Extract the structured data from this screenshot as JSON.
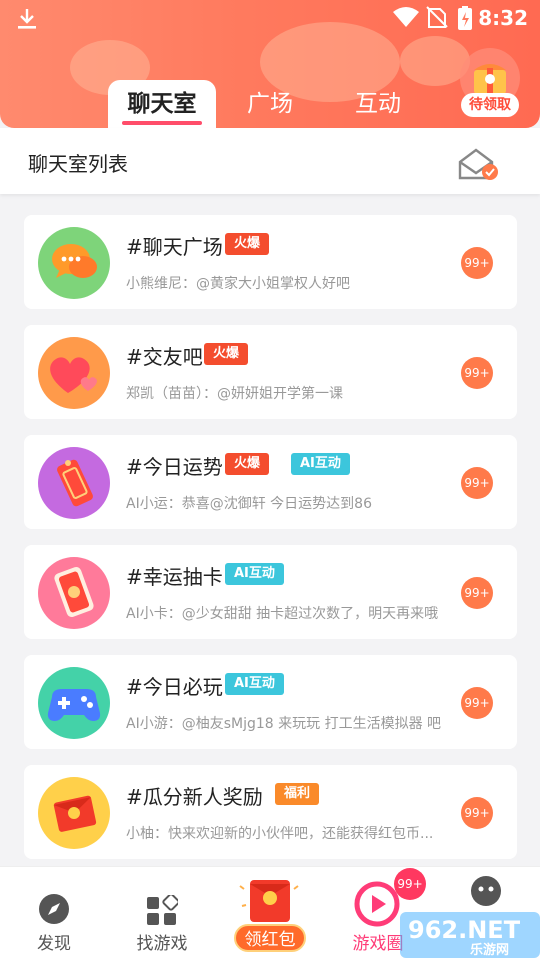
{
  "status_bar": {
    "time": "8:32"
  },
  "tabs": [
    {
      "label": "聊天室",
      "active": true
    },
    {
      "label": "广场",
      "active": false
    },
    {
      "label": "互动",
      "active": false
    }
  ],
  "gift": {
    "badge": "待领取"
  },
  "subheader": {
    "title": "聊天室列表"
  },
  "rooms": [
    {
      "name": "#聊天广场",
      "tags": [
        {
          "text": "火爆",
          "kind": "hot"
        }
      ],
      "message": "小熊维尼：@黄家大小姐掌权人好吧",
      "badge": "99+",
      "icon": "chat-bubbles-icon"
    },
    {
      "name": "#交友吧",
      "tags": [
        {
          "text": "火爆",
          "kind": "hot"
        }
      ],
      "message": "郑凯（苗苗）：@妍妍姐开学第一课",
      "badge": "99+",
      "icon": "hearts-icon"
    },
    {
      "name": "#今日运势",
      "tags": [
        {
          "text": "火爆",
          "kind": "hot"
        },
        {
          "text": "AI互动",
          "kind": "ai"
        }
      ],
      "message": "AI小运：恭喜@沈御轩 今日运势达到86",
      "badge": "99+",
      "icon": "fortune-tag-icon"
    },
    {
      "name": "#幸运抽卡",
      "tags": [
        {
          "text": "AI互动",
          "kind": "ai"
        }
      ],
      "message": "AI小卡：@少女甜甜 抽卡超过次数了，明天再来哦",
      "badge": "99+",
      "icon": "lucky-card-icon"
    },
    {
      "name": "#今日必玩",
      "tags": [
        {
          "text": "AI互动",
          "kind": "ai"
        }
      ],
      "message": "AI小游：@柚友sMjg18 来玩玩 打工生活模拟器 吧",
      "badge": "99+",
      "icon": "gamepad-icon"
    },
    {
      "name": "#瓜分新人奖励",
      "tags": [
        {
          "text": "福利",
          "kind": "fuli"
        }
      ],
      "message": "小柚：快来欢迎新的小伙伴吧，还能获得红包币...",
      "badge": "99+",
      "icon": "red-envelope-icon"
    }
  ],
  "bottom_nav": [
    {
      "label": "发现",
      "icon": "compass-icon"
    },
    {
      "label": "找游戏",
      "icon": "grid-icon"
    },
    {
      "label": "领红包",
      "icon": "red-envelope-icon"
    },
    {
      "label": "游戏圈",
      "icon": "play-circle-icon",
      "badge": "99+"
    },
    {
      "label": "",
      "icon": "robot-face-icon"
    }
  ],
  "watermark": {
    "text": "962.NET",
    "sub": "乐游网"
  },
  "colors": {
    "header": "#ff7a5e",
    "hot": "#f44d2e",
    "ai": "#3cc6dc",
    "fuli": "#fa8a2a",
    "badge": "#ff7a4a"
  }
}
